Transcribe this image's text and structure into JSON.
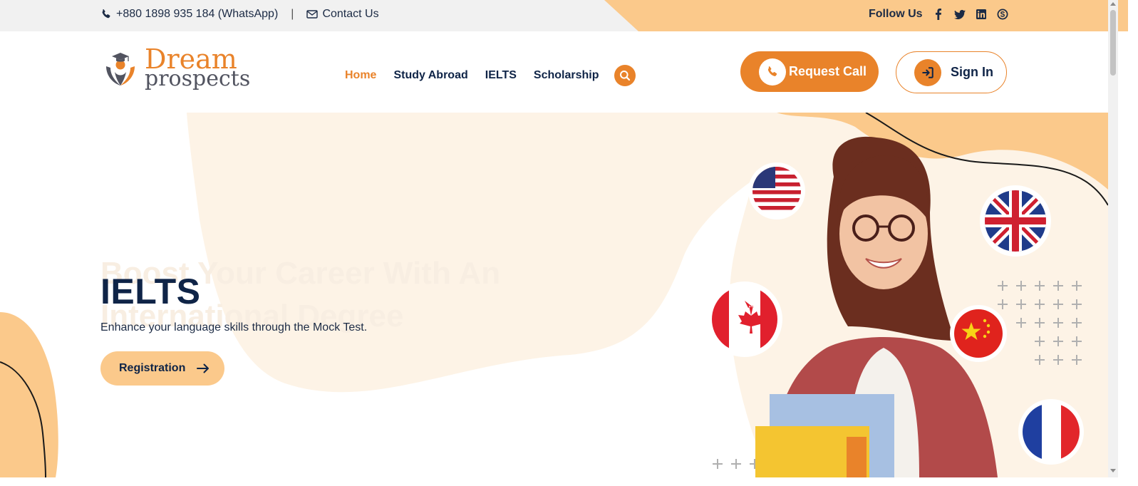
{
  "topbar": {
    "phone": "+880 1898 935 184 (WhatsApp)",
    "separator": "|",
    "contact": "Contact Us",
    "follow_label": "Follow Us",
    "socials": [
      "facebook-icon",
      "twitter-icon",
      "linkedin-icon",
      "skype-icon"
    ]
  },
  "header": {
    "logo_line1": "Dream",
    "logo_line2": "prospects",
    "nav": [
      {
        "label": "Home",
        "active": true
      },
      {
        "label": "Study Abroad",
        "active": false
      },
      {
        "label": "IELTS",
        "active": false
      },
      {
        "label": "Scholarship",
        "active": false
      }
    ],
    "request_call": "Request Call",
    "sign_in": "Sign In"
  },
  "hero": {
    "ghost_text": "Boost Your Career With An International Degree",
    "title": "IELTS",
    "subtitle": "Enhance your language skills through the Mock Test.",
    "cta": "Registration",
    "flags": [
      "usa-flag",
      "uk-flag",
      "canada-flag",
      "china-flag",
      "france-flag"
    ]
  },
  "colors": {
    "accent": "#e9832a",
    "accent_light": "#fbc98b",
    "navy": "#0f2447",
    "topbar_bg": "#f1f1f1"
  }
}
